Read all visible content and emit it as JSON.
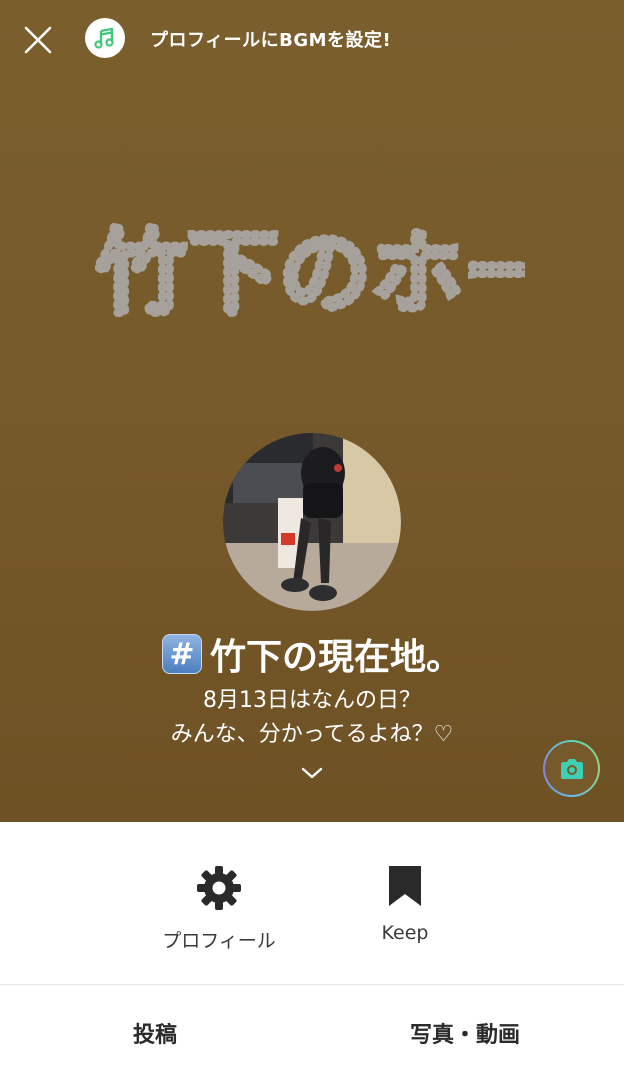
{
  "header": {
    "bgm_text": "プロフィールにBGMを設定!"
  },
  "cover": {
    "handwritten_title": "竹下のホーム",
    "background_color": "#7a5f2d"
  },
  "profile": {
    "hash_symbol": "#",
    "name": "竹下の現在地。",
    "status_line1": "8月13日はなんの日？",
    "status_line2": "みんな、分かってるよね？♡"
  },
  "actions": {
    "profile_label": "プロフィール",
    "keep_label": "Keep"
  },
  "tabs": {
    "posts_label": "投稿",
    "media_label": "写真・動画"
  },
  "icons": {
    "close": "close-icon",
    "bgm": "music-note-icon",
    "camera": "camera-icon",
    "settings": "gear-icon",
    "keep": "bookmark-icon",
    "expand": "chevron-down-icon"
  },
  "colors": {
    "accent_green": "#3fc77a",
    "camera_teal": "#3fcfb5"
  }
}
